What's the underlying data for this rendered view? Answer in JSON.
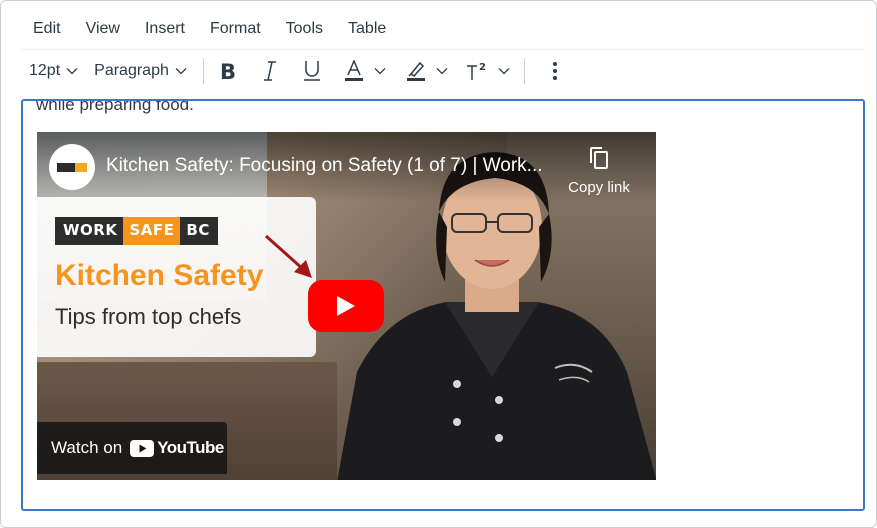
{
  "menubar": {
    "items": [
      "Edit",
      "View",
      "Insert",
      "Format",
      "Tools",
      "Table"
    ]
  },
  "toolbar": {
    "font_size": "12pt",
    "block_format": "Paragraph",
    "bold_icon": "bold-icon",
    "italic_icon": "italic-icon",
    "underline_icon": "underline-icon",
    "text_color_icon": "text-color-icon",
    "highlight_icon": "highlight-icon",
    "superscript_icon": "superscript-icon",
    "more_icon": "more-vertical-icon"
  },
  "editor": {
    "text": "while preparing food."
  },
  "video": {
    "title": "Kitchen Safety: Focusing on Safety (1 of 7) | Work...",
    "copy_link": "Copy link",
    "brand": [
      "WORK",
      "SAFE",
      "BC"
    ],
    "promo_title": "Kitchen Safety",
    "promo_subtitle": "Tips from top chefs",
    "watch_on": "Watch on",
    "youtube": "YouTube"
  },
  "colors": {
    "accent": "#3b78c3",
    "play": "#ff0000",
    "brand_orange": "#f7941d",
    "arrow": "#a4161a"
  }
}
